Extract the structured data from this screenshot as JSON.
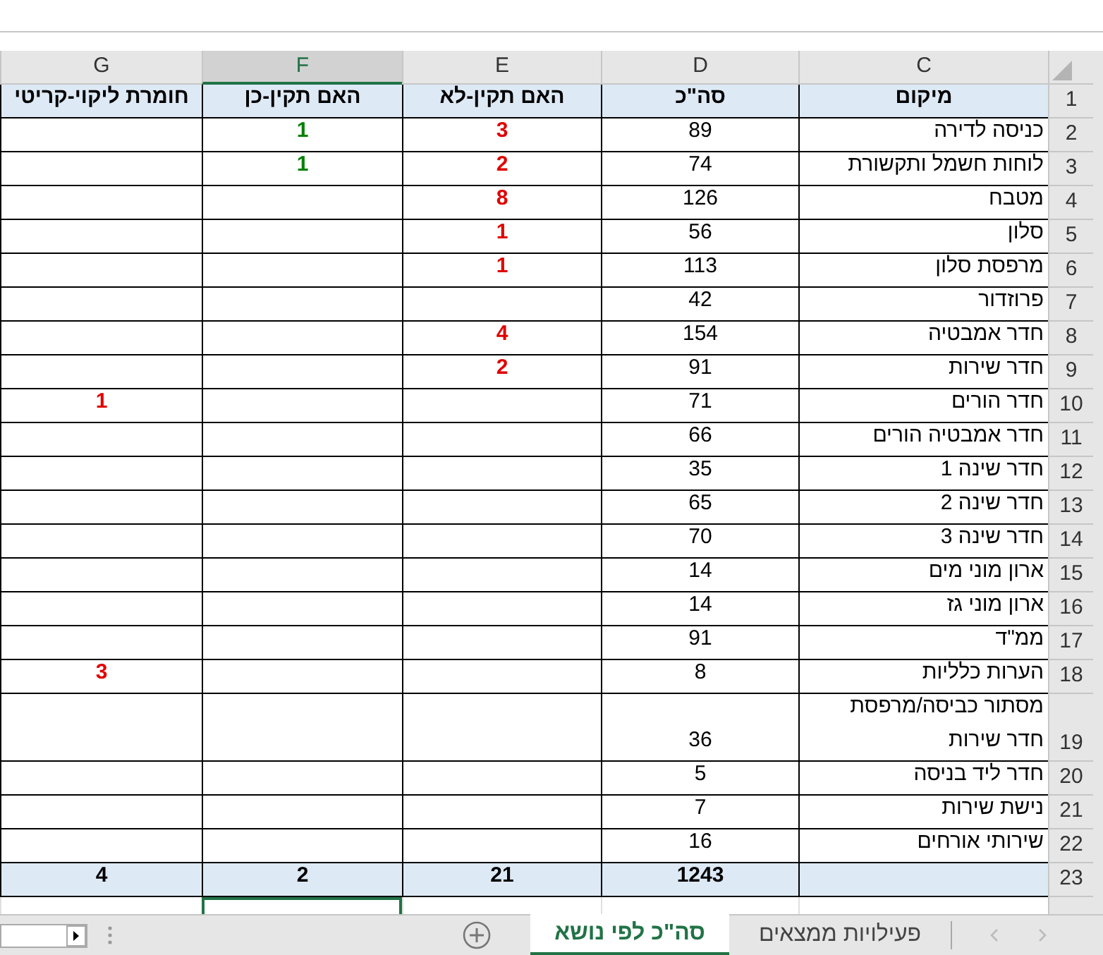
{
  "columns": [
    {
      "letter": "C",
      "selected": false
    },
    {
      "letter": "D",
      "selected": false
    },
    {
      "letter": "E",
      "selected": false
    },
    {
      "letter": "F",
      "selected": true
    },
    {
      "letter": "G",
      "selected": false
    }
  ],
  "header": {
    "num": "1",
    "cells": [
      "מיקום",
      "סה\"כ",
      "האם תקין-לא",
      "האם תקין-כן",
      "חומרת ליקוי-קריטי"
    ]
  },
  "rows": [
    {
      "num": "2",
      "location": "כניסה לדירה",
      "total": "89",
      "not_ok": "3",
      "ok": "1"
    },
    {
      "num": "3",
      "location": "לוחות חשמל ותקשורת",
      "total": "74",
      "not_ok": "2",
      "ok": "1"
    },
    {
      "num": "4",
      "location": "מטבח",
      "total": "126",
      "not_ok": "8"
    },
    {
      "num": "5",
      "location": "סלון",
      "total": "56",
      "not_ok": "1"
    },
    {
      "num": "6",
      "location": "מרפסת סלון",
      "total": "113",
      "not_ok": "1"
    },
    {
      "num": "7",
      "location": "פרוזדור",
      "total": "42"
    },
    {
      "num": "8",
      "location": "חדר אמבטיה",
      "total": "154",
      "not_ok": "4"
    },
    {
      "num": "9",
      "location": "חדר שירות",
      "total": "91",
      "not_ok": "2"
    },
    {
      "num": "10",
      "location": "חדר הורים",
      "total": "71",
      "critical": "1"
    },
    {
      "num": "11",
      "location": "חדר אמבטיה הורים",
      "total": "66"
    },
    {
      "num": "12",
      "location": "חדר שינה 1",
      "total": "35"
    },
    {
      "num": "13",
      "location": "חדר שינה 2",
      "total": "65"
    },
    {
      "num": "14",
      "location": "חדר שינה 3",
      "total": "70"
    },
    {
      "num": "15",
      "location": "ארון מוני מים",
      "total": "14"
    },
    {
      "num": "16",
      "location": "ארון מוני גז",
      "total": "14"
    },
    {
      "num": "17",
      "location": "ממ\"ד",
      "total": "91"
    },
    {
      "num": "18",
      "location": "הערות כלליות",
      "total": "8",
      "critical": "3"
    },
    {
      "num": "19",
      "location": "מסתור כביסה/מרפסת חדר שירות",
      "total": "36"
    },
    {
      "num": "20",
      "location": "חדר ליד בניסה",
      "total": "5"
    },
    {
      "num": "21",
      "location": "נישת שירות",
      "total": "7"
    },
    {
      "num": "22",
      "location": "שירותי אורחים",
      "total": "16"
    }
  ],
  "totals": {
    "num": "23",
    "total": "1243",
    "not_ok": "21",
    "ok": "2",
    "critical": "4"
  },
  "sheet_tabs": [
    {
      "label": "פעילויות ממצאים",
      "selected": false
    },
    {
      "label": "סה\"כ לפי נושא",
      "selected": true
    }
  ]
}
